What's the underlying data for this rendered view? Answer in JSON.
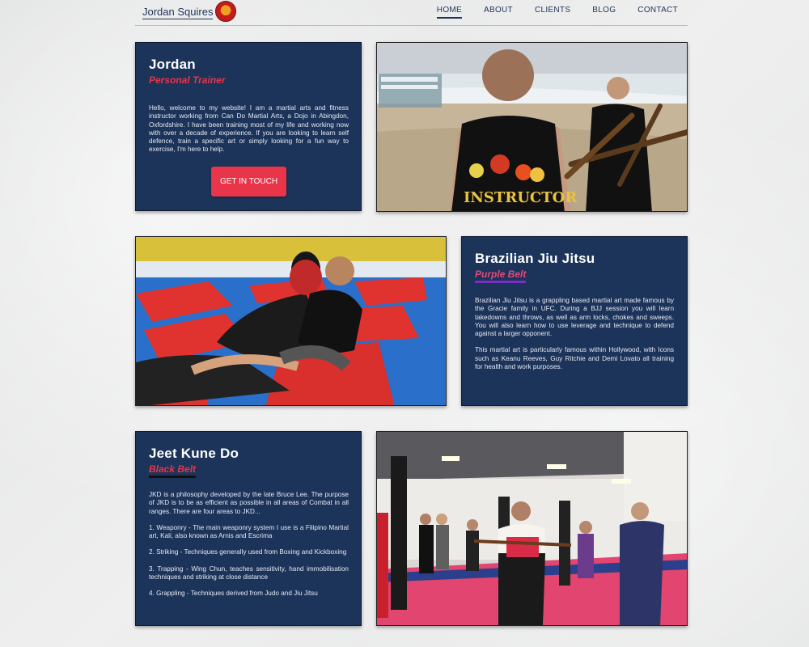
{
  "nav": {
    "brand": "Jordan Squires",
    "links": [
      "HOME",
      "ABOUT",
      "CLIENTS",
      "BLOG",
      "CONTACT"
    ]
  },
  "intro": {
    "title": "Jordan",
    "subtitle": "Personal Trainer",
    "body": "Hello, welcome to my website! I am a martial arts and fitness instructor working from Can Do Martial Arts, a Dojo in Abingdon, Oxfordshire. I have been training most of my life and working now with over a decade of experience. If you are looking to learn self defence, train a specific art or simply looking for a fun way to exercise, I'm here to help.",
    "cta": "GET IN TOUCH"
  },
  "bjj": {
    "title": "Brazilian Jiu Jitsu",
    "subtitle": "Purple Belt",
    "p1": "Brazilian Jiu Jitsu is a grappling based martial art made famous by the Gracie family in UFC. During a BJJ session you will learn takedowns and throws, as well as arm locks, chokes and sweeps. You will also learn how to use leverage and technique to defend against a larger opponent.",
    "p2": "This martial art is particularly famous within Hollywood, with Icons such as Keanu Reeves, Guy Ritchie and Demi Lovato all training for health and work purposes."
  },
  "jkd": {
    "title": "Jeet Kune Do",
    "subtitle": "Black Belt",
    "p1": "JKD is a philosophy developed by the late Bruce Lee. The purpose of JKD is to be as efficient as possible in all areas of Combat in all ranges. There are four areas to JKD...",
    "p2": "1. Weaponry - The main weaponry system I use is a Filipino Martial art, Kali, also known as Arnis and Escrima",
    "p3": "2. Striking - Techniques generally used from Boxing and Kickboxing",
    "p4": "3. Trapping - Wing Chun, teaches sensitivity, hand immobilisation techniques and striking at close distance",
    "p5": "4. Grappling - Techniques derived from Judo and Jiu Jitsu"
  },
  "photos": {
    "beach_shirt_text": "INSTRUCTOR"
  },
  "colors": {
    "card": "#1c335a",
    "accent": "#e8354a",
    "purple": "#7a2cc6",
    "black_belt": "#111111"
  }
}
